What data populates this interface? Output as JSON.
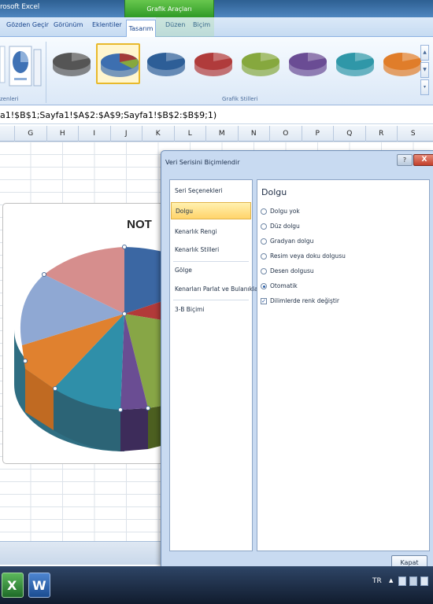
{
  "window": {
    "app_title": "rosoft Excel"
  },
  "ribbon": {
    "context_header": "Grafik Araçları",
    "tabs": [
      "Gözden Geçir",
      "Görünüm",
      "Eklentiler",
      "Tasarım",
      "Düzen",
      "Biçim"
    ],
    "active_tab": "Tasarım",
    "group_layouts": "zenleri",
    "group_styles": "Grafik Stilleri",
    "style_colors": [
      "#555555",
      "#3d6fb0",
      "#2d5e97",
      "#b03b3b",
      "#86a83e",
      "#6a4c94",
      "#2f97a8",
      "#e07d2a"
    ],
    "selected_style_index": 1
  },
  "formula_bar": {
    "text": "a1!$B$1;Sayfa1!$A$2:$A$9;Sayfa1!$B$2:$B$9;1)"
  },
  "columns": [
    "G",
    "H",
    "I",
    "J",
    "K",
    "L",
    "M",
    "N",
    "O",
    "P",
    "Q",
    "R",
    "S"
  ],
  "chart": {
    "title": "NOT"
  },
  "dialog": {
    "title": "Veri Serisini Biçimlendir",
    "help_label": "?",
    "close_label": "X",
    "nav_items": [
      "Seri Seçenekleri",
      "Dolgu",
      "Kenarlık Rengi",
      "Kenarlık Stilleri",
      "Gölge",
      "Kenarları Parlat ve Bulanıklaştır",
      "3-B Biçimi"
    ],
    "selected_nav": "Dolgu",
    "section_heading": "Dolgu",
    "fill_options": [
      "Dolgu yok",
      "Düz dolgu",
      "Gradyan dolgu",
      "Resim veya doku dolgusu",
      "Desen dolgusu",
      "Otomatik"
    ],
    "selected_fill": "Otomatik",
    "vary_colors_label": "Dilimlerde renk değiştir",
    "vary_colors_checked": true,
    "close_button": "Kapat"
  },
  "taskbar": {
    "language": "TR",
    "arrow": "▲"
  }
}
